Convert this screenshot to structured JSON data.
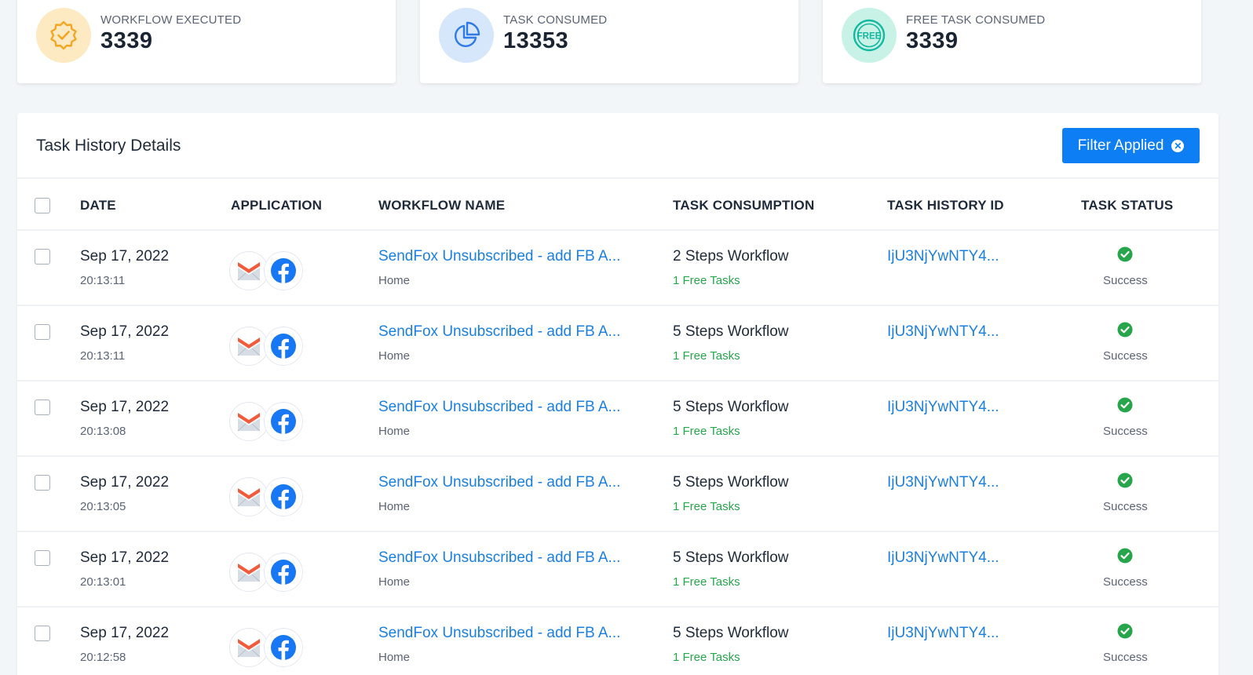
{
  "stats": [
    {
      "label": "WORKFLOW EXECUTED",
      "value": "3339",
      "icon": "badge-check-icon",
      "bg": "#fdeac3",
      "color": "#f2a623"
    },
    {
      "label": "TASK CONSUMED",
      "value": "13353",
      "icon": "pie-chart-icon",
      "bg": "#d6e6fb",
      "color": "#2f7ae6"
    },
    {
      "label": "FREE TASK CONSUMED",
      "value": "3339",
      "icon": "free-badge-icon",
      "bg": "#c9f2e6",
      "color": "#14b8a0"
    }
  ],
  "panel": {
    "title": "Task History Details",
    "filter_label": "Filter Applied",
    "filter_clear_icon": "close-circle-icon"
  },
  "columns": {
    "date": "DATE",
    "application": "APPLICATION",
    "workflow_name": "WORKFLOW NAME",
    "task_consumption": "TASK CONSUMPTION",
    "task_history_id": "TASK HISTORY ID",
    "task_status": "TASK STATUS"
  },
  "rows": [
    {
      "date": "Sep 17, 2022",
      "time": "20:13:11",
      "apps": [
        "sendfox-icon",
        "facebook-icon"
      ],
      "workflow": "SendFox Unsubscribed - add FB A...",
      "folder": "Home",
      "steps": "2 Steps Workflow",
      "free": "1 Free Tasks",
      "id": "IjU3NjYwNTY4...",
      "status": "Success"
    },
    {
      "date": "Sep 17, 2022",
      "time": "20:13:11",
      "apps": [
        "sendfox-icon",
        "facebook-icon"
      ],
      "workflow": "SendFox Unsubscribed - add FB A...",
      "folder": "Home",
      "steps": "5 Steps Workflow",
      "free": "1 Free Tasks",
      "id": "IjU3NjYwNTY4...",
      "status": "Success"
    },
    {
      "date": "Sep 17, 2022",
      "time": "20:13:08",
      "apps": [
        "sendfox-icon",
        "facebook-icon"
      ],
      "workflow": "SendFox Unsubscribed - add FB A...",
      "folder": "Home",
      "steps": "5 Steps Workflow",
      "free": "1 Free Tasks",
      "id": "IjU3NjYwNTY4...",
      "status": "Success"
    },
    {
      "date": "Sep 17, 2022",
      "time": "20:13:05",
      "apps": [
        "sendfox-icon",
        "facebook-icon"
      ],
      "workflow": "SendFox Unsubscribed - add FB A...",
      "folder": "Home",
      "steps": "5 Steps Workflow",
      "free": "1 Free Tasks",
      "id": "IjU3NjYwNTY4...",
      "status": "Success"
    },
    {
      "date": "Sep 17, 2022",
      "time": "20:13:01",
      "apps": [
        "sendfox-icon",
        "facebook-icon"
      ],
      "workflow": "SendFox Unsubscribed - add FB A...",
      "folder": "Home",
      "steps": "5 Steps Workflow",
      "free": "1 Free Tasks",
      "id": "IjU3NjYwNTY4...",
      "status": "Success"
    },
    {
      "date": "Sep 17, 2022",
      "time": "20:12:58",
      "apps": [
        "sendfox-icon",
        "facebook-icon"
      ],
      "workflow": "SendFox Unsubscribed - add FB A...",
      "folder": "Home",
      "steps": "5 Steps Workflow",
      "free": "1 Free Tasks",
      "id": "IjU3NjYwNTY4...",
      "status": "Success"
    }
  ],
  "colors": {
    "accent": "#0d7ef3",
    "link": "#1a7fe0",
    "success": "#27a54a"
  }
}
